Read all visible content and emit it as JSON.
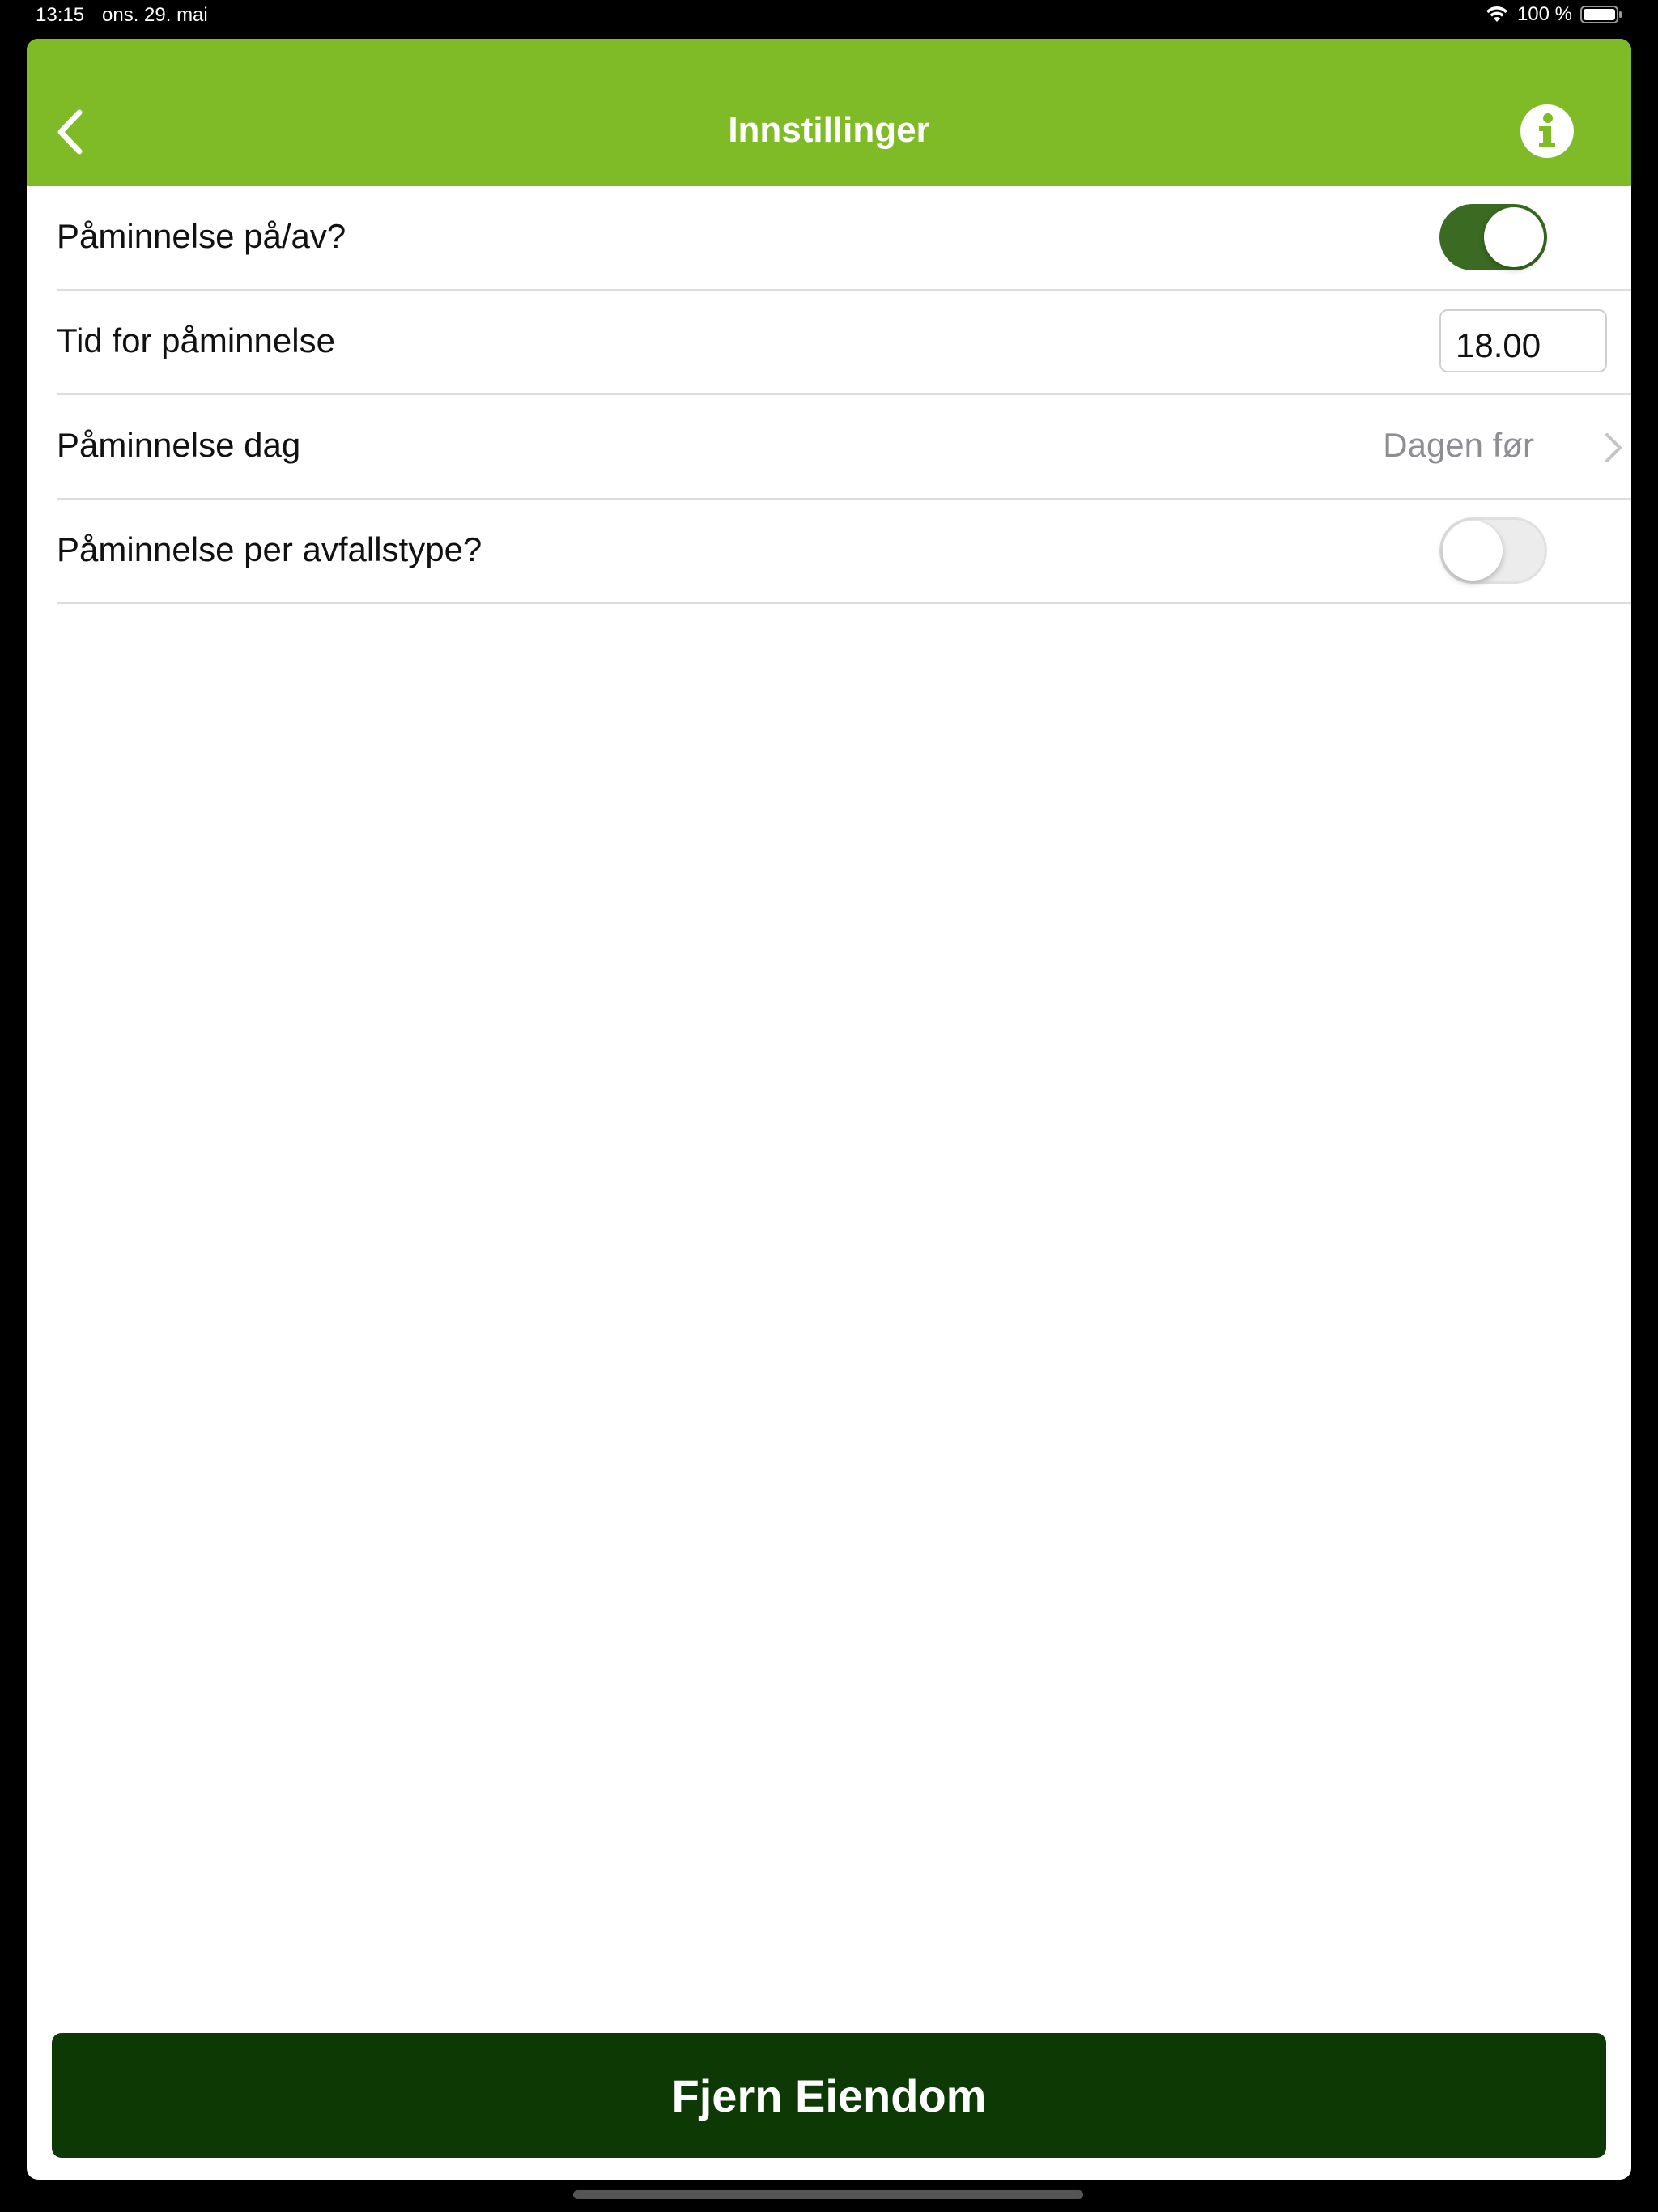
{
  "status_bar": {
    "time": "13:15",
    "date": "ons. 29. mai",
    "battery": "100 %"
  },
  "navbar": {
    "title": "Innstillinger",
    "back_icon": "chevron-left-icon",
    "info_icon": "info-icon",
    "color": "#7fbb26"
  },
  "settings": {
    "reminder_toggle": {
      "label": "Påminnelse på/av?",
      "on": true
    },
    "reminder_time": {
      "label": "Tid for påminnelse",
      "value": "18.00"
    },
    "reminder_day": {
      "label": "Påminnelse dag",
      "value": "Dagen før"
    },
    "per_waste_type": {
      "label": "Påminnelse per avfallstype?",
      "on": false
    }
  },
  "footer": {
    "remove_button": "Fjern Eiendom",
    "button_color": "#0d3a04"
  }
}
